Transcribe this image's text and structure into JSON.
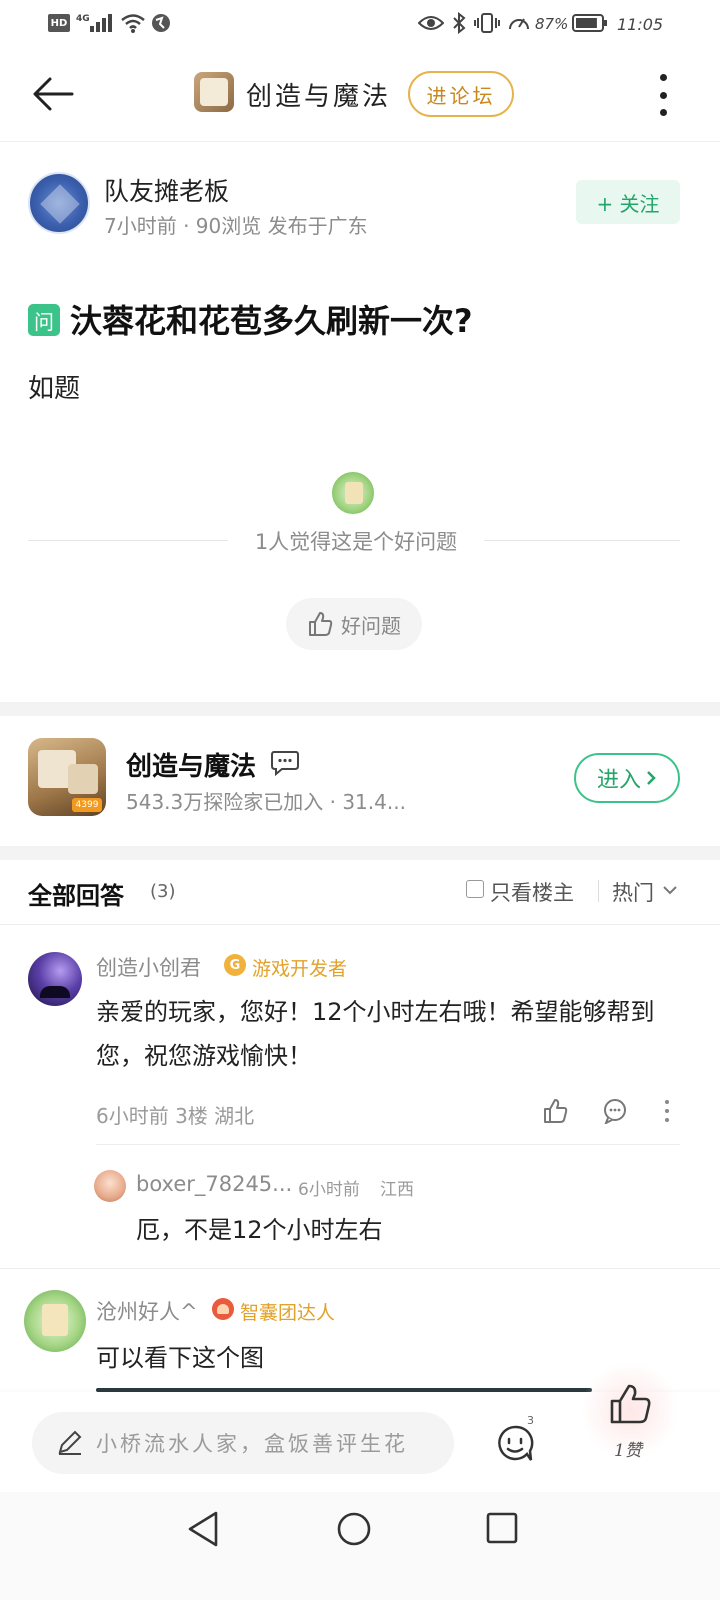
{
  "status": {
    "hd": "HD",
    "network": "4G",
    "battery": "87%",
    "battery_level": 0.87,
    "time": "11:05"
  },
  "topbar": {
    "title": "创造与魔法",
    "forum_button": "进论坛"
  },
  "author": {
    "name": "队友摊老板",
    "meta": "7小时前 · 90浏览  发布于广东",
    "follow": "+ 关注"
  },
  "question": {
    "tag": "问",
    "title": "汏蓉花和花苞多久刷新一次?",
    "body": "如题",
    "liked_text": "1人觉得这是个好问题",
    "good_button": "好问题"
  },
  "game": {
    "name": "创造与魔法",
    "sub": "543.3万探险家已加入 · 31.4...",
    "enter": "进入",
    "icon_badge": "4399"
  },
  "answers": {
    "title": "全部回答",
    "count": "(3)",
    "op_only": "只看楼主",
    "sort": "热门",
    "items": [
      {
        "name": "创造小创君",
        "badge_icon": "G",
        "badge": "游戏开发者",
        "text": "亲爱的玩家，您好！12个小时左右哦！希望能够帮到您，祝您游戏愉快！",
        "meta": "6小时前  3楼  湖北",
        "reply": {
          "name": "boxer_78245...",
          "time": "6小时前",
          "loc": "江西",
          "text": "厄，不是12个小时左右"
        }
      },
      {
        "name": "沧州好人^",
        "badge": "智囊团达人",
        "text": "可以看下这个图"
      }
    ]
  },
  "bottom": {
    "input_placeholder": "小桥流水人家，盒饭善评生花",
    "comment_count": "3",
    "like_label": "1赞"
  },
  "icons": {
    "back": "arrow-left-icon",
    "more": "more-vertical-icon",
    "chat": "chat-bubble-icon",
    "like": "thumbs-up-icon",
    "pen": "pen-icon"
  },
  "colors": {
    "accent_green": "#23a66a",
    "forum_gold": "#c8881c",
    "badge_gold": "#e0a22a"
  }
}
